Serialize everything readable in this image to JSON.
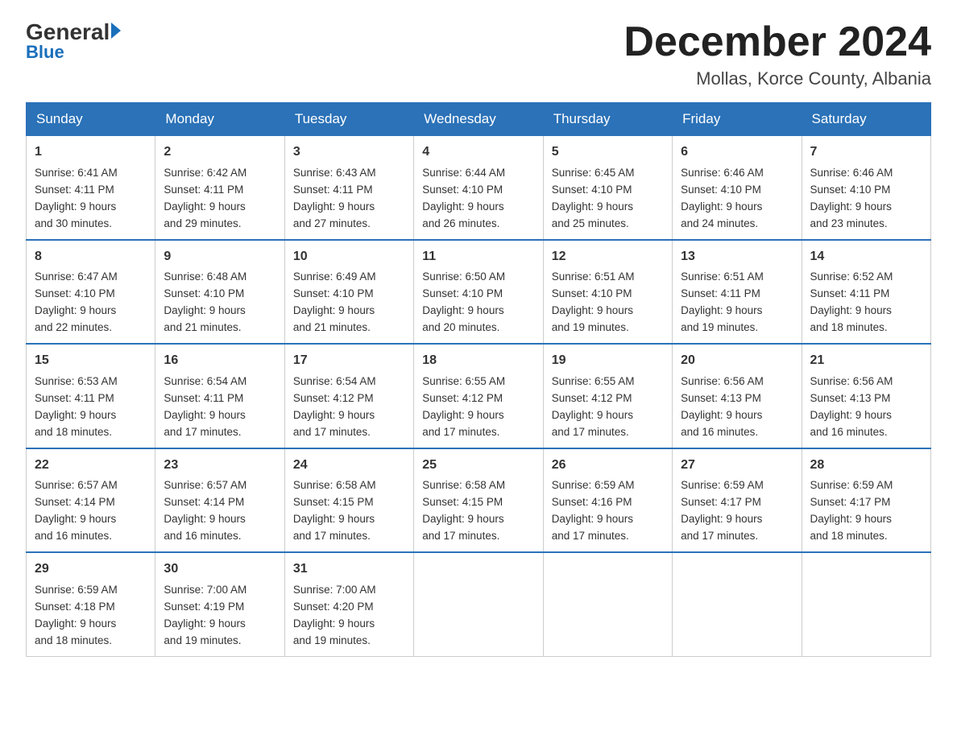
{
  "logo": {
    "general": "General",
    "arrow": "",
    "blue": "Blue"
  },
  "title": "December 2024",
  "location": "Mollas, Korce County, Albania",
  "days": [
    "Sunday",
    "Monday",
    "Tuesday",
    "Wednesday",
    "Thursday",
    "Friday",
    "Saturday"
  ],
  "weeks": [
    [
      {
        "num": "1",
        "sunrise": "6:41 AM",
        "sunset": "4:11 PM",
        "daylight": "9 hours and 30 minutes."
      },
      {
        "num": "2",
        "sunrise": "6:42 AM",
        "sunset": "4:11 PM",
        "daylight": "9 hours and 29 minutes."
      },
      {
        "num": "3",
        "sunrise": "6:43 AM",
        "sunset": "4:11 PM",
        "daylight": "9 hours and 27 minutes."
      },
      {
        "num": "4",
        "sunrise": "6:44 AM",
        "sunset": "4:10 PM",
        "daylight": "9 hours and 26 minutes."
      },
      {
        "num": "5",
        "sunrise": "6:45 AM",
        "sunset": "4:10 PM",
        "daylight": "9 hours and 25 minutes."
      },
      {
        "num": "6",
        "sunrise": "6:46 AM",
        "sunset": "4:10 PM",
        "daylight": "9 hours and 24 minutes."
      },
      {
        "num": "7",
        "sunrise": "6:46 AM",
        "sunset": "4:10 PM",
        "daylight": "9 hours and 23 minutes."
      }
    ],
    [
      {
        "num": "8",
        "sunrise": "6:47 AM",
        "sunset": "4:10 PM",
        "daylight": "9 hours and 22 minutes."
      },
      {
        "num": "9",
        "sunrise": "6:48 AM",
        "sunset": "4:10 PM",
        "daylight": "9 hours and 21 minutes."
      },
      {
        "num": "10",
        "sunrise": "6:49 AM",
        "sunset": "4:10 PM",
        "daylight": "9 hours and 21 minutes."
      },
      {
        "num": "11",
        "sunrise": "6:50 AM",
        "sunset": "4:10 PM",
        "daylight": "9 hours and 20 minutes."
      },
      {
        "num": "12",
        "sunrise": "6:51 AM",
        "sunset": "4:10 PM",
        "daylight": "9 hours and 19 minutes."
      },
      {
        "num": "13",
        "sunrise": "6:51 AM",
        "sunset": "4:11 PM",
        "daylight": "9 hours and 19 minutes."
      },
      {
        "num": "14",
        "sunrise": "6:52 AM",
        "sunset": "4:11 PM",
        "daylight": "9 hours and 18 minutes."
      }
    ],
    [
      {
        "num": "15",
        "sunrise": "6:53 AM",
        "sunset": "4:11 PM",
        "daylight": "9 hours and 18 minutes."
      },
      {
        "num": "16",
        "sunrise": "6:54 AM",
        "sunset": "4:11 PM",
        "daylight": "9 hours and 17 minutes."
      },
      {
        "num": "17",
        "sunrise": "6:54 AM",
        "sunset": "4:12 PM",
        "daylight": "9 hours and 17 minutes."
      },
      {
        "num": "18",
        "sunrise": "6:55 AM",
        "sunset": "4:12 PM",
        "daylight": "9 hours and 17 minutes."
      },
      {
        "num": "19",
        "sunrise": "6:55 AM",
        "sunset": "4:12 PM",
        "daylight": "9 hours and 17 minutes."
      },
      {
        "num": "20",
        "sunrise": "6:56 AM",
        "sunset": "4:13 PM",
        "daylight": "9 hours and 16 minutes."
      },
      {
        "num": "21",
        "sunrise": "6:56 AM",
        "sunset": "4:13 PM",
        "daylight": "9 hours and 16 minutes."
      }
    ],
    [
      {
        "num": "22",
        "sunrise": "6:57 AM",
        "sunset": "4:14 PM",
        "daylight": "9 hours and 16 minutes."
      },
      {
        "num": "23",
        "sunrise": "6:57 AM",
        "sunset": "4:14 PM",
        "daylight": "9 hours and 16 minutes."
      },
      {
        "num": "24",
        "sunrise": "6:58 AM",
        "sunset": "4:15 PM",
        "daylight": "9 hours and 17 minutes."
      },
      {
        "num": "25",
        "sunrise": "6:58 AM",
        "sunset": "4:15 PM",
        "daylight": "9 hours and 17 minutes."
      },
      {
        "num": "26",
        "sunrise": "6:59 AM",
        "sunset": "4:16 PM",
        "daylight": "9 hours and 17 minutes."
      },
      {
        "num": "27",
        "sunrise": "6:59 AM",
        "sunset": "4:17 PM",
        "daylight": "9 hours and 17 minutes."
      },
      {
        "num": "28",
        "sunrise": "6:59 AM",
        "sunset": "4:17 PM",
        "daylight": "9 hours and 18 minutes."
      }
    ],
    [
      {
        "num": "29",
        "sunrise": "6:59 AM",
        "sunset": "4:18 PM",
        "daylight": "9 hours and 18 minutes."
      },
      {
        "num": "30",
        "sunrise": "7:00 AM",
        "sunset": "4:19 PM",
        "daylight": "9 hours and 19 minutes."
      },
      {
        "num": "31",
        "sunrise": "7:00 AM",
        "sunset": "4:20 PM",
        "daylight": "9 hours and 19 minutes."
      },
      null,
      null,
      null,
      null
    ]
  ],
  "labels": {
    "sunrise": "Sunrise:",
    "sunset": "Sunset:",
    "daylight": "Daylight:"
  }
}
